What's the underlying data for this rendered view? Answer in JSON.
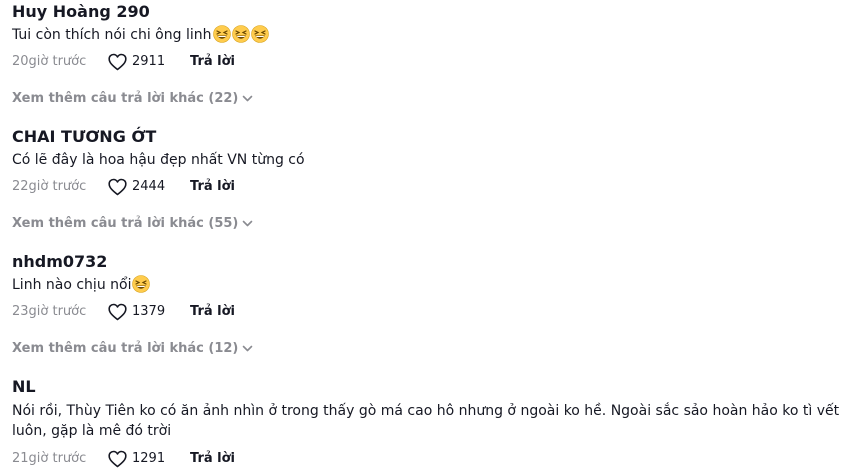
{
  "reply_label": "Trả lời",
  "comments": [
    {
      "username": "Huy Hoàng 290",
      "text": "Tui còn thích nói chi ông linh",
      "emoji": [
        "grinning-squint-emoji",
        "grinning-squint-emoji",
        "grinning-squint-emoji"
      ],
      "time": "20giờ trước",
      "likes": "2911",
      "more_replies": "Xem thêm câu trả lời khác (22)"
    },
    {
      "username": "CHAI TƯƠNG ỚT",
      "text": "Có lẽ đây là hoa hậu đẹp nhất VN từng có",
      "emoji": [],
      "time": "22giờ trước",
      "likes": "2444",
      "more_replies": "Xem thêm câu trả lời khác (55)"
    },
    {
      "username": "nhdm0732",
      "text": "Linh nào chịu nổi",
      "emoji": [
        "grinning-squint-emoji"
      ],
      "time": "23giờ trước",
      "likes": "1379",
      "more_replies": "Xem thêm câu trả lời khác (12)"
    },
    {
      "username": "NL",
      "text": "Nói rồi, Thùy Tiên ko có ăn ảnh nhìn ở trong thấy gò má cao hô nhưng ở ngoài ko hề. Ngoài sắc sảo hoàn hảo ko tì vết luôn, gặp là mê đó trời",
      "emoji": [],
      "time": "21giờ trước",
      "likes": "1291"
    }
  ],
  "colors": {
    "text_primary": "#161823",
    "text_secondary": "#8a8b91",
    "emoji_face": "#ffcc4d",
    "emoji_mouth": "#664500"
  }
}
